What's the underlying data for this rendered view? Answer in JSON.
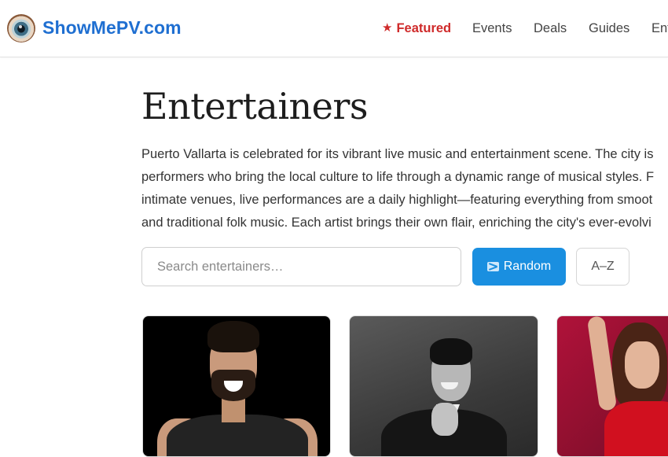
{
  "header": {
    "brand": "ShowMePV.com",
    "logo_icon": "eye-icon",
    "nav": [
      {
        "label": "Featured",
        "icon": "star-icon",
        "active": true,
        "color": "#cf2a2a"
      },
      {
        "label": "Events"
      },
      {
        "label": "Deals"
      },
      {
        "label": "Guides"
      },
      {
        "label": "Ent"
      }
    ]
  },
  "main": {
    "title": "Entertainers",
    "intro_lines": [
      "Puerto Vallarta is celebrated for its vibrant live music and entertainment scene. The city is",
      "performers who bring the local culture to life through a dynamic range of musical styles. F",
      "intimate venues, live performances are a daily highlight—featuring everything from smoot",
      "and traditional folk music. Each artist brings their own flair, enriching the city's ever-evolvi"
    ],
    "search": {
      "placeholder": "Search entertainers…",
      "value": ""
    },
    "random_button": {
      "label": "Random",
      "icon": "shuffle-icon"
    },
    "az_button": {
      "label": "A–Z"
    }
  },
  "cards": [
    {
      "name": "entertainer-card-1"
    },
    {
      "name": "entertainer-card-2"
    },
    {
      "name": "entertainer-card-3"
    }
  ],
  "colors": {
    "brand": "#1f6fd1",
    "featured": "#cf2a2a",
    "primary_button": "#1a8fe0"
  }
}
